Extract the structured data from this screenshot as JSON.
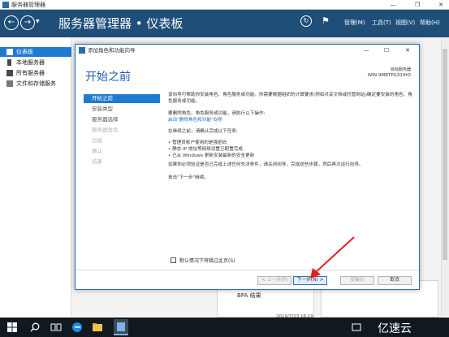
{
  "window": {
    "title": "服务器管理器"
  },
  "header": {
    "title": "服务器管理器 • 仪表板",
    "menus": [
      "管理(M)",
      "工具(T)",
      "视图(V)",
      "帮助(H)"
    ]
  },
  "sidebar": {
    "items": [
      {
        "label": "仪表板",
        "active": true
      },
      {
        "label": "本地服务器"
      },
      {
        "label": "所有服务器"
      },
      {
        "label": "文件和存储服务"
      }
    ]
  },
  "background": {
    "bpa_label": "BPA 结果",
    "date": "2019/7/23 16:19"
  },
  "dialog": {
    "title": "添加角色和功能向导",
    "heading": "开始之前",
    "target_label": "目标服务器",
    "target_server": "WIN-9MBTPG31IHO",
    "steps": [
      {
        "label": "开始之前",
        "state": "active"
      },
      {
        "label": "安装类型",
        "state": "enabled"
      },
      {
        "label": "服务器选择",
        "state": "enabled"
      },
      {
        "label": "服务器角色",
        "state": "disabled"
      },
      {
        "label": "功能",
        "state": "disabled"
      },
      {
        "label": "确认",
        "state": "disabled"
      },
      {
        "label": "结果",
        "state": "disabled"
      }
    ],
    "paragraph1": "该向导可帮助你安装角色、角色服务或功能。你需要根据组织的计算要求(例如共享文档或托管网站)确定要安装的角色、角色服务或功能。",
    "remove_line": "要删除角色、角色服务或功能，请执行以下操作:",
    "remove_link": "启动\"删除角色和功能\"向导",
    "before_intro": "在继续之前，请确认完成以下任务:",
    "tasks": [
      "• 管理员帐户使用的是强密码",
      "• 静态 IP 地址等网络设置已配置完成",
      "• 已从 Windows 更新安装最新的安全更新"
    ],
    "verify_text": "如果你必须验证是否已完成上述任何先决条件，请关闭向导，完成这些步骤，然后再次运行向导。",
    "continue_text": "单击\"下一步\"继续。",
    "skip_checkbox": "默认情况下将跳过此页(S)",
    "buttons": {
      "prev": "< 上一步(P)",
      "next": "下一步(N) >",
      "install": "安装(I)",
      "cancel": "取消"
    }
  },
  "taskbar": {
    "watermark": "亿速云"
  },
  "colors": {
    "header": "#1f4e79",
    "accent": "#1f7bd0",
    "arrow": "#e02020"
  }
}
